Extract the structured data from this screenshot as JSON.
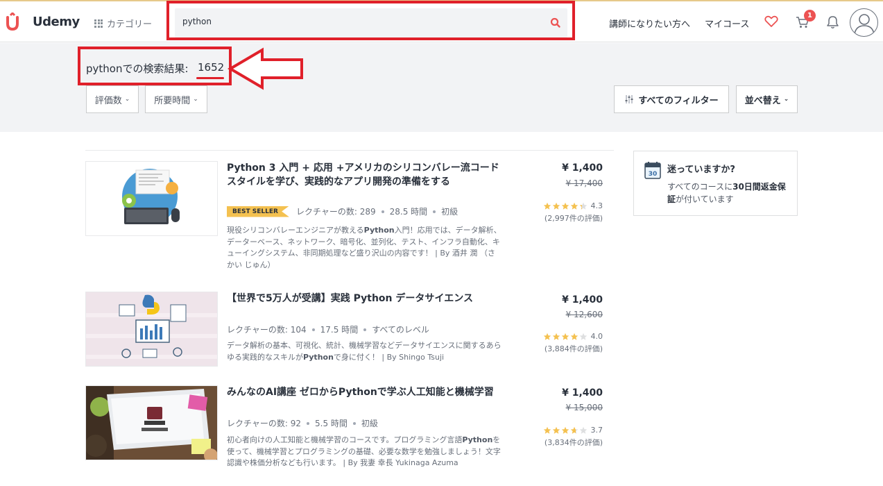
{
  "header": {
    "logo_text": "Udemy",
    "categories_label": "カテゴリー",
    "search_value": "python",
    "instructor_link": "講師になりたい方へ",
    "my_courses_link": "マイコース",
    "cart_count": "1",
    "icons": [
      "udemy-logo",
      "grid-icon",
      "search-icon",
      "heart-icon",
      "cart-icon",
      "bell-icon",
      "avatar-icon"
    ]
  },
  "results": {
    "title_prefix": "pythonでの検索結果:",
    "count": "1652"
  },
  "filters": {
    "ratings": "評価数",
    "duration": "所要時間",
    "all_filters": "すべてのフィルター",
    "sort": "並べ替え"
  },
  "courses": [
    {
      "title": "Python 3 入門 + 応用 +アメリカのシリコンバレー流コードスタイルを学び、実践的なアプリ開発の準備をする",
      "badge": "BEST SELLER",
      "lectures": "レクチャーの数: 289",
      "hours": "28.5 時間",
      "level": "初級",
      "desc_pre": "現役シリコンバレーエンジニアが教える",
      "desc_bold": "Python",
      "desc_post": "入門！応用では、データ解析、データーベース、ネットワーク、暗号化、並列化、テスト、インフラ自動化、キューイングシステム、非同期処理など盛り沢山の内容です！ | By 酒井 潤 （さかい じゅん）",
      "price": "¥ 1,400",
      "old_price": "¥ 17,400",
      "rating": "4.3",
      "rating_value": 4.3,
      "reviews": "(2,997件の評価)"
    },
    {
      "title": "【世界で5万人が受講】実践 Python データサイエンス",
      "badge": "",
      "lectures": "レクチャーの数: 104",
      "hours": "17.5 時間",
      "level": "すべてのレベル",
      "desc_pre": "データ解析の基本、可視化、統計、機械学習などデータサイエンスに関するあらゆる実践的なスキルが",
      "desc_bold": "Python",
      "desc_post": "で身に付く！ | By Shingo Tsuji",
      "price": "¥ 1,400",
      "old_price": "¥ 12,600",
      "rating": "4.0",
      "rating_value": 4.0,
      "reviews": "(3,884件の評価)"
    },
    {
      "title": "みんなのAI講座 ゼロからPythonで学ぶ人工知能と機械学習",
      "badge": "",
      "lectures": "レクチャーの数: 92",
      "hours": "5.5 時間",
      "level": "初級",
      "desc_pre": "初心者向けの人工知能と機械学習のコースです。プログラミング言語",
      "desc_bold": "Python",
      "desc_post": "を使って、機械学習とプログラミングの基礎、必要な数学を勉強しましょう！文字認識や株価分析なども行います。 | By 我妻 幸長 Yukinaga Azuma",
      "price": "¥ 1,400",
      "old_price": "¥ 15,000",
      "rating": "3.7",
      "rating_value": 3.7,
      "reviews": "(3,834件の評価)"
    }
  ],
  "sidebar": {
    "title": "迷っていますか?",
    "body_pre": "すべてのコースに",
    "body_bold": "30日間返金保証",
    "body_post": "が付いています",
    "icon_day": "30"
  },
  "colors": {
    "highlight_red": "#e0202a",
    "star": "#f4c150",
    "badge": "#f4c150",
    "cart_badge": "#ec5252"
  }
}
